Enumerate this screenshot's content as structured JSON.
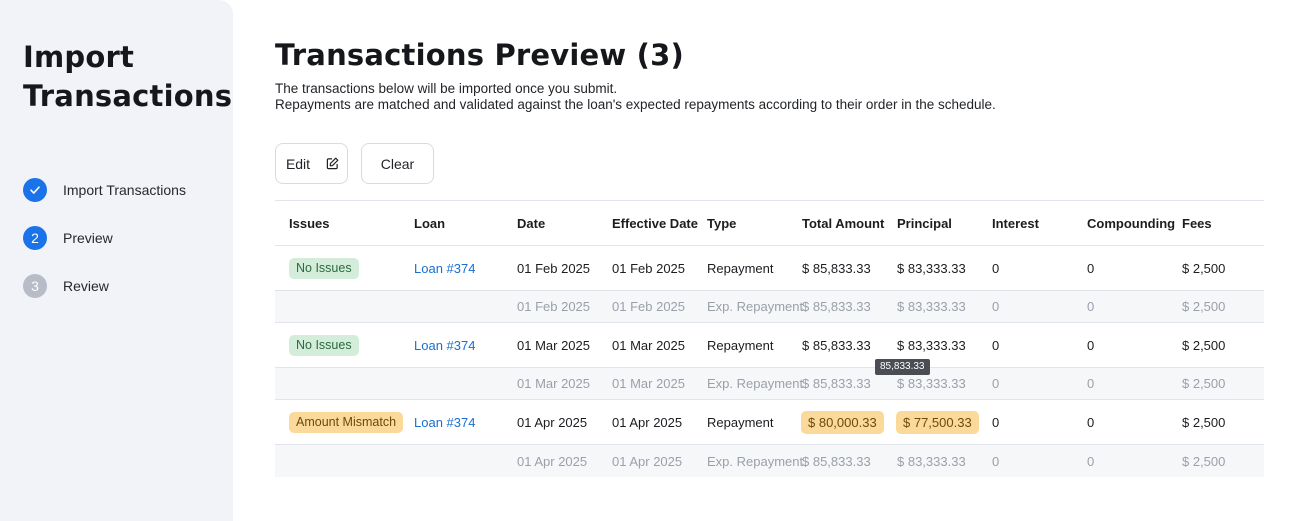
{
  "sidebar": {
    "title_line1": "Import",
    "title_line2": "Transactions",
    "steps": [
      {
        "number": "",
        "label": "Import Transactions",
        "state": "done"
      },
      {
        "number": "2",
        "label": "Preview",
        "state": "active"
      },
      {
        "number": "3",
        "label": "Review",
        "state": "pending"
      }
    ]
  },
  "main": {
    "title": "Transactions Preview (3)",
    "desc_line1": "The transactions below will be imported once you submit.",
    "desc_line2": "Repayments are matched and validated against the loan's expected repayments according to their order in the schedule.",
    "toolbar": {
      "edit_label": "Edit",
      "clear_label": "Clear"
    },
    "table": {
      "headers": [
        "Issues",
        "Loan",
        "Date",
        "Effective Date",
        "Type",
        "Total Amount",
        "Principal",
        "Interest",
        "Compounding",
        "Fees"
      ],
      "groups": [
        {
          "issue": "No Issues",
          "issue_type": "ok",
          "loan": "Loan #374",
          "date": "01 Feb 2025",
          "effective": "01 Feb 2025",
          "type": "Repayment",
          "total": "$ 85,833.33",
          "principal": "$ 83,333.33",
          "interest": "0",
          "compounding": "0",
          "fees": "$ 2,500",
          "exp": {
            "date": "01 Feb 2025",
            "effective": "01 Feb 2025",
            "type": "Exp. Repayment",
            "total": "$ 85,833.33",
            "principal": "$ 83,333.33",
            "interest": "0",
            "compounding": "0",
            "fees": "$ 2,500"
          }
        },
        {
          "issue": "No Issues",
          "issue_type": "ok",
          "loan": "Loan #374",
          "date": "01 Mar 2025",
          "effective": "01 Mar 2025",
          "type": "Repayment",
          "total": "$ 85,833.33",
          "principal": "$ 83,333.33",
          "interest": "0",
          "compounding": "0",
          "fees": "$ 2,500",
          "exp": {
            "date": "01 Mar 2025",
            "effective": "01 Mar 2025",
            "type": "Exp. Repayment",
            "total": "$ 85,833.33",
            "principal": "$ 83,333.33",
            "interest": "0",
            "compounding": "0",
            "fees": "$ 2,500"
          }
        },
        {
          "issue": "Amount Mismatch",
          "issue_type": "warn",
          "loan": "Loan #374",
          "date": "01 Apr 2025",
          "effective": "01 Apr 2025",
          "type": "Repayment",
          "total": "$ 80,000.33",
          "principal": "$ 77,500.33",
          "interest": "0",
          "compounding": "0",
          "fees": "$ 2,500",
          "exp": {
            "date": "01 Apr 2025",
            "effective": "01 Apr 2025",
            "type": "Exp. Repayment",
            "total": "$ 85,833.33",
            "principal": "$ 83,333.33",
            "interest": "0",
            "compounding": "0",
            "fees": "$ 2,500"
          }
        }
      ]
    },
    "tooltip": "85,833.33"
  }
}
